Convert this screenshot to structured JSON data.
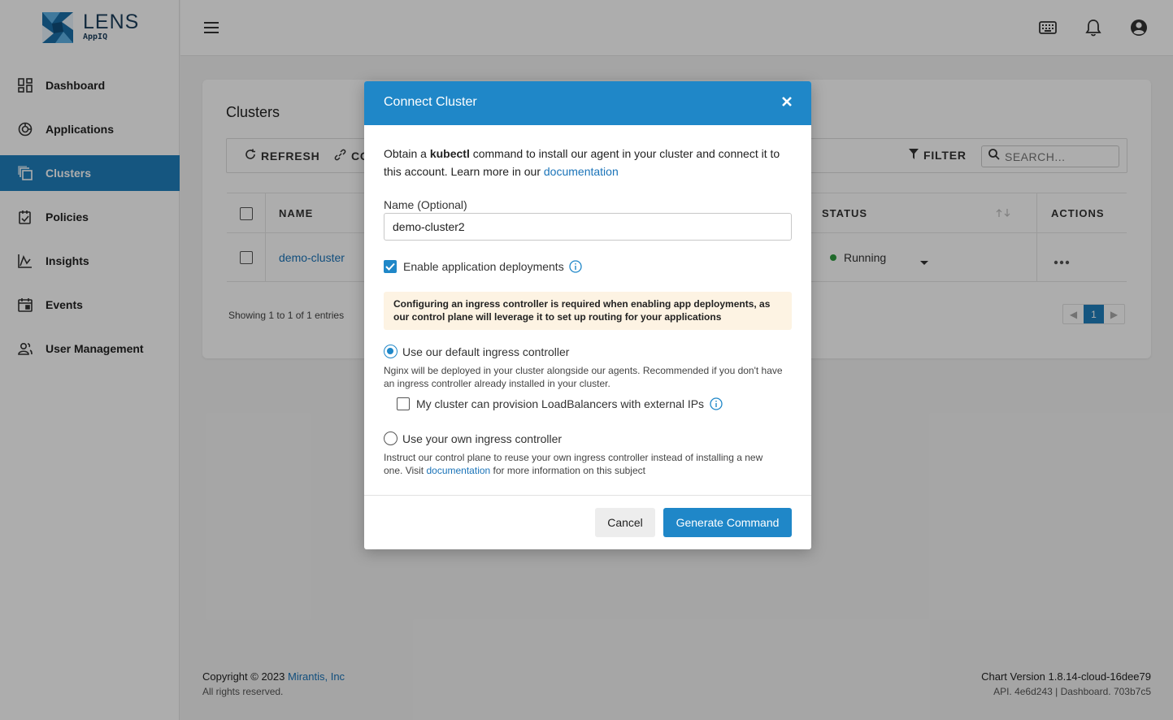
{
  "brand": {
    "name": "LENS",
    "sub": "AppIQ"
  },
  "sidebar": {
    "items": [
      {
        "label": "Dashboard",
        "icon": "dashboard-icon"
      },
      {
        "label": "Applications",
        "icon": "applications-icon"
      },
      {
        "label": "Clusters",
        "icon": "clusters-icon",
        "active": true
      },
      {
        "label": "Policies",
        "icon": "policies-icon"
      },
      {
        "label": "Insights",
        "icon": "insights-icon"
      },
      {
        "label": "Events",
        "icon": "events-icon"
      },
      {
        "label": "User Management",
        "icon": "user-management-icon"
      }
    ]
  },
  "topbar": {
    "icons": [
      "keyboard-icon",
      "bell-icon",
      "account-icon"
    ]
  },
  "page": {
    "title": "Clusters",
    "toolbar": {
      "refresh": "REFRESH",
      "connect": "CO",
      "filter": "FILTER",
      "search_placeholder": "SEARCH..."
    },
    "table": {
      "headers": {
        "name": "NAME",
        "status": "STATUS",
        "actions": "ACTIONS"
      },
      "rows": [
        {
          "name": "demo-cluster",
          "status": "Running",
          "status_color": "#2e9b3e"
        }
      ]
    },
    "showing": "Showing 1 to 1 of 1 entries",
    "pager": {
      "current": "1"
    }
  },
  "footer": {
    "copyright": "Copyright © 2023 ",
    "company": "Mirantis, Inc",
    "rights": "All rights reserved.",
    "chart_version": "Chart Version 1.8.14-cloud-16dee79",
    "api": "API. 4e6d243 | Dashboard. 703b7c5"
  },
  "modal": {
    "title": "Connect Cluster",
    "intro_pre": "Obtain a ",
    "intro_bold": "kubectl",
    "intro_post": " command to install our agent in your cluster and connect it to this account. Learn more in our ",
    "intro_link": "documentation",
    "name_label": "Name (Optional)",
    "name_value": "demo-cluster2",
    "enable_label": "Enable application deployments",
    "warning": "Configuring an ingress controller is required when enabling app deployments, as our control plane will leverage it to set up routing for your applications",
    "option_default": "Use our default ingress controller",
    "option_default_desc": "Nginx will be deployed in your cluster alongside our agents. Recommended if you don't have an ingress controller already installed in your cluster.",
    "lb_label": "My cluster can provision LoadBalancers with external IPs",
    "option_own": "Use your own ingress controller",
    "option_own_desc_pre": "Instruct our control plane to reuse your own ingress controller instead of installing a new one. Visit ",
    "option_own_link": "documentation",
    "option_own_desc_post": " for more information on this subject",
    "cancel": "Cancel",
    "generate": "Generate Command"
  },
  "colors": {
    "accent": "#1f87c8",
    "sidebar_active": "#1f7fbd",
    "link": "#1a73b8",
    "warning_bg": "#fdf3e3"
  }
}
